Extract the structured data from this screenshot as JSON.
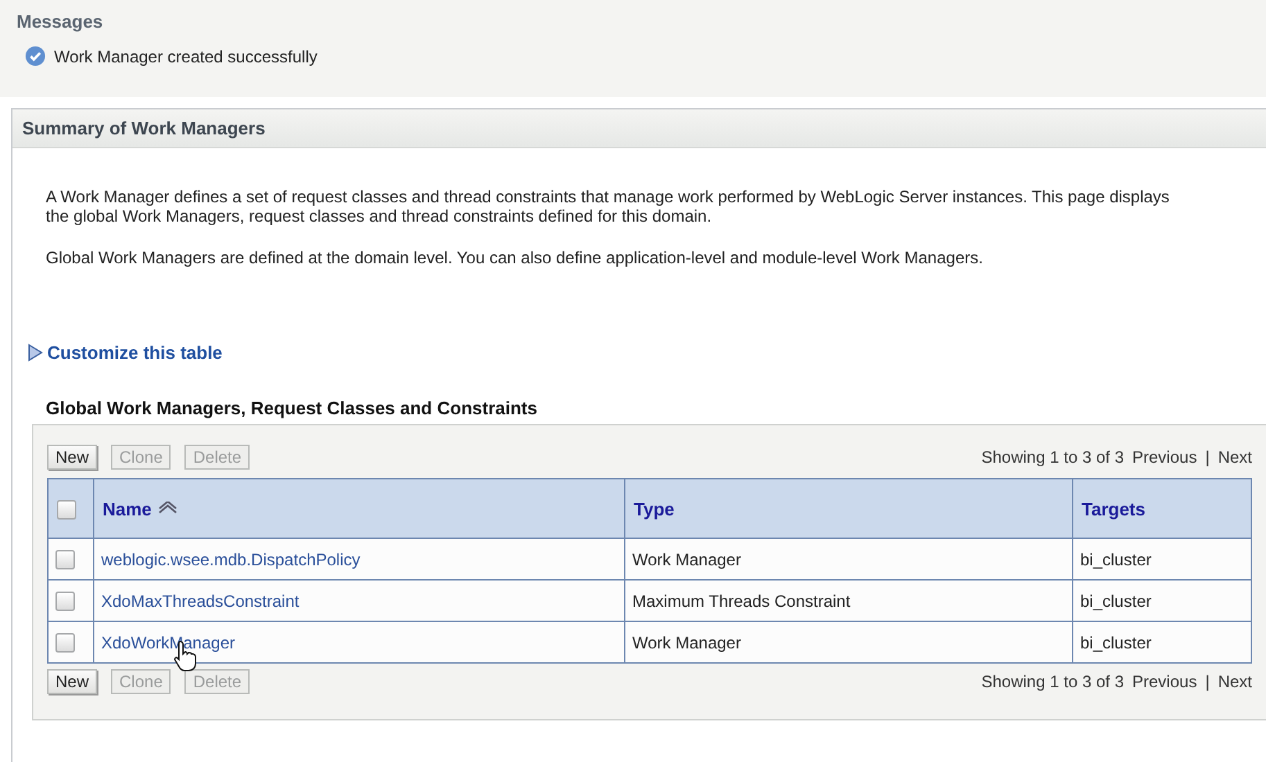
{
  "messages": {
    "title": "Messages",
    "items": [
      "Work Manager created successfully"
    ]
  },
  "summary": {
    "title": "Summary of Work Managers",
    "paragraphs": [
      "A Work Manager defines a set of request classes and thread constraints that manage work performed by WebLogic Server instances. This page displays the global Work Managers, request classes and thread constraints defined for this domain.",
      "Global Work Managers are defined at the domain level. You can also define application-level and module-level Work Managers."
    ],
    "customize_link": "Customize this table",
    "table_title": "Global Work Managers, Request Classes and Constraints",
    "top_bar": {
      "buttons": [
        {
          "label": "New",
          "disabled": false
        },
        {
          "label": "Clone",
          "disabled": true
        },
        {
          "label": "Delete",
          "disabled": true
        }
      ],
      "pagination": {
        "showing": "Showing 1 to 3 of 3",
        "previous": "Previous",
        "separator": "|",
        "next": "Next"
      }
    },
    "bottom_bar": {
      "buttons": [
        {
          "label": "New",
          "disabled": false
        },
        {
          "label": "Clone",
          "disabled": true
        },
        {
          "label": "Delete",
          "disabled": true
        }
      ],
      "pagination": {
        "showing": "Showing 1 to 3 of 3",
        "previous": "Previous",
        "separator": "|",
        "next": "Next"
      }
    },
    "columns": [
      {
        "label": "Name",
        "sorted": true
      },
      {
        "label": "Type",
        "sorted": false
      },
      {
        "label": "Targets",
        "sorted": false
      }
    ],
    "header_checkbox": {
      "checked": false
    },
    "rows": [
      {
        "checked": false,
        "name": "weblogic.wsee.mdb.DispatchPolicy",
        "type": "Work Manager",
        "targets": "bi_cluster"
      },
      {
        "checked": false,
        "name": "XdoMaxThreadsConstraint",
        "type": "Maximum Threads Constraint",
        "targets": "bi_cluster"
      },
      {
        "checked": false,
        "name": "XdoWorkManager",
        "type": "Work Manager",
        "targets": "bi_cluster",
        "hovered": true
      }
    ]
  }
}
